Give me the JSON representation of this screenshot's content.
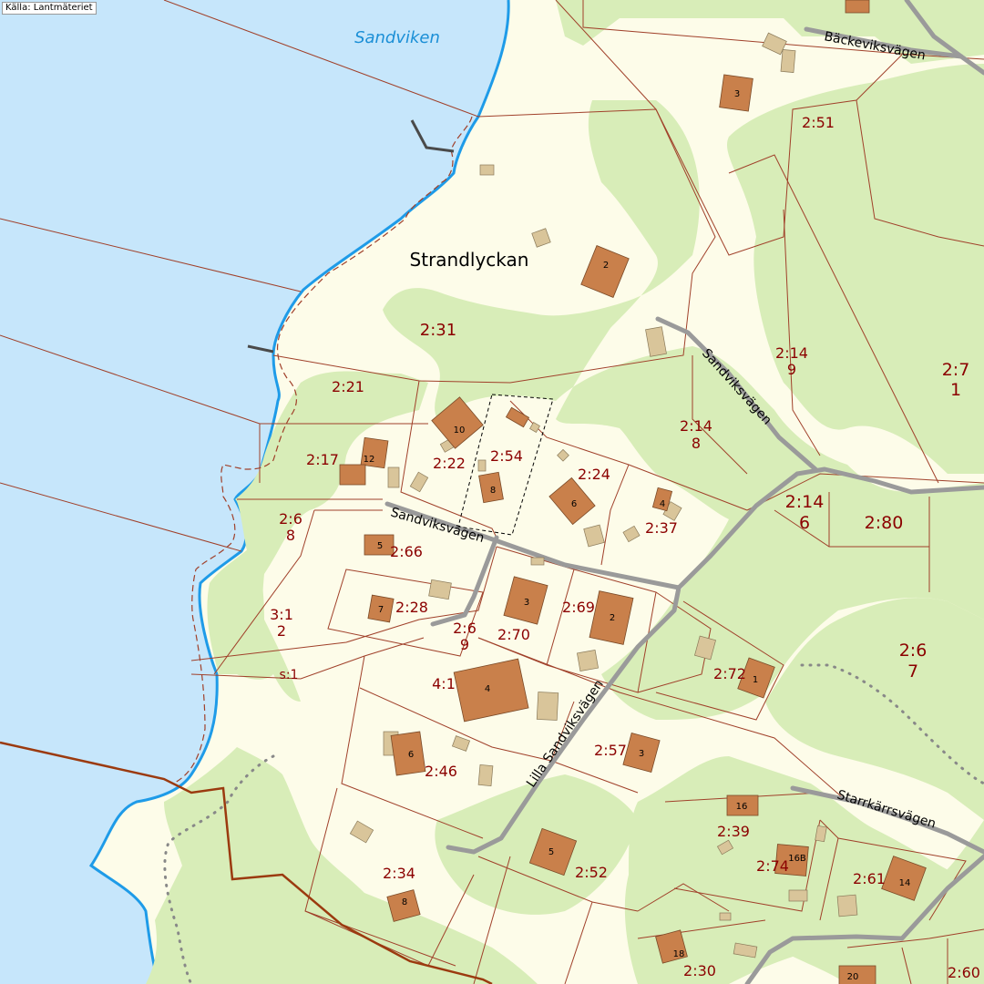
{
  "attribution": "Källa: Lantmäteriet",
  "water_names": {
    "sandviken": "Sandviken"
  },
  "place_names": {
    "strandlyckan": "Strandlyckan"
  },
  "roads": {
    "backeviksvagen": "Bäckeviksvägen",
    "sandviksvagen_upper": "Sandviksvägen",
    "sandviksvagen_lower": "Sandviksvägen",
    "lilla_sandviksvagen": "Lilla Sandviksvägen",
    "starrkarrsvagen": "Starrkärrsvägen"
  },
  "parcels": {
    "p251": "2:51",
    "p231": "2:31",
    "p221": "2:21",
    "p217": "2:17",
    "p222": "2:22",
    "p254": "2:54",
    "p224": "2:24",
    "p237": "2:37",
    "p2149a": "2:14",
    "p2149b": "9",
    "p2148a": "2:14",
    "p2148b": "8",
    "p271a": "2:7",
    "p271b": "1",
    "p2146a": "2:14",
    "p2146b": "6",
    "p280": "2:80",
    "p268a": "2:6",
    "p268b": "8",
    "p266": "2:66",
    "p312a": "3:1",
    "p312b": "2",
    "p228": "2:28",
    "p269a": "2:6",
    "p269b": "9",
    "p270": "2:70",
    "p2_69": "2:69",
    "p41": "4:1",
    "ps1": "s:1",
    "p272": "2:72",
    "p267a": "2:6",
    "p267b": "7",
    "p257": "2:57",
    "p246": "2:46",
    "p239": "2:39",
    "p274": "2:74",
    "p261": "2:61",
    "p252": "2:52",
    "p234": "2:34",
    "p230": "2:30",
    "p260": "2:60"
  },
  "house_numbers": {
    "h3_top": "3",
    "h2_top": "2",
    "h10": "10",
    "h12": "12",
    "h8_mid": "8",
    "h6_mid": "6",
    "h4_mid": "4",
    "h5_left": "5",
    "h7": "7",
    "h3_mid": "3",
    "h2_mid": "2",
    "h4_low": "4",
    "h1": "1",
    "h6_low": "6",
    "h3_low": "3",
    "h16": "16",
    "h16b": "16B",
    "h14": "14",
    "h5_low": "5",
    "h8_low": "8",
    "h18": "18",
    "h20": "20"
  },
  "colors": {
    "water": "#c6e6fb",
    "shoreline": "#1e9be8",
    "land": "#fdfce9",
    "forest": "#d8edb8",
    "building_residential": "#c9804b",
    "building_other": "#d9c59a",
    "property_line": "#a0402a",
    "road": "#999999",
    "parcel_label": "#8b0000",
    "municipal_border": "#9b3a0f"
  }
}
